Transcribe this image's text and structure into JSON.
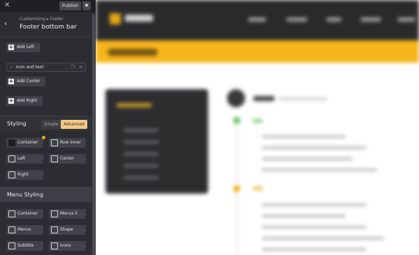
{
  "topbar": {
    "close": "✕",
    "publish": "Publish",
    "gear": "✱"
  },
  "header": {
    "back": "‹",
    "breadcrumb": "Customizing ▸ Footer",
    "title": "Footer bottom bar"
  },
  "buttons": {
    "add_left": "Add Left",
    "add_center": "Add Center",
    "add_right": "Add Right"
  },
  "item": {
    "label": "Icon and text",
    "chevron": "›",
    "copy": "❐",
    "trash": "🗑"
  },
  "styling": {
    "label": "Styling",
    "simple": "Simple",
    "advanced": "Advanced"
  },
  "styling_tiles": [
    "Container",
    "Row inner",
    "Left",
    "Center",
    "Right"
  ],
  "menu_styling": {
    "label": "Menu Styling"
  },
  "menu_tiles": [
    "Container",
    "Menus li",
    "Menus",
    "Shape",
    "Subtitle",
    "Icons"
  ],
  "colors": {
    "accent": "#f2c88a",
    "indicator": "#f5a623",
    "panel": "#2b2d33"
  }
}
